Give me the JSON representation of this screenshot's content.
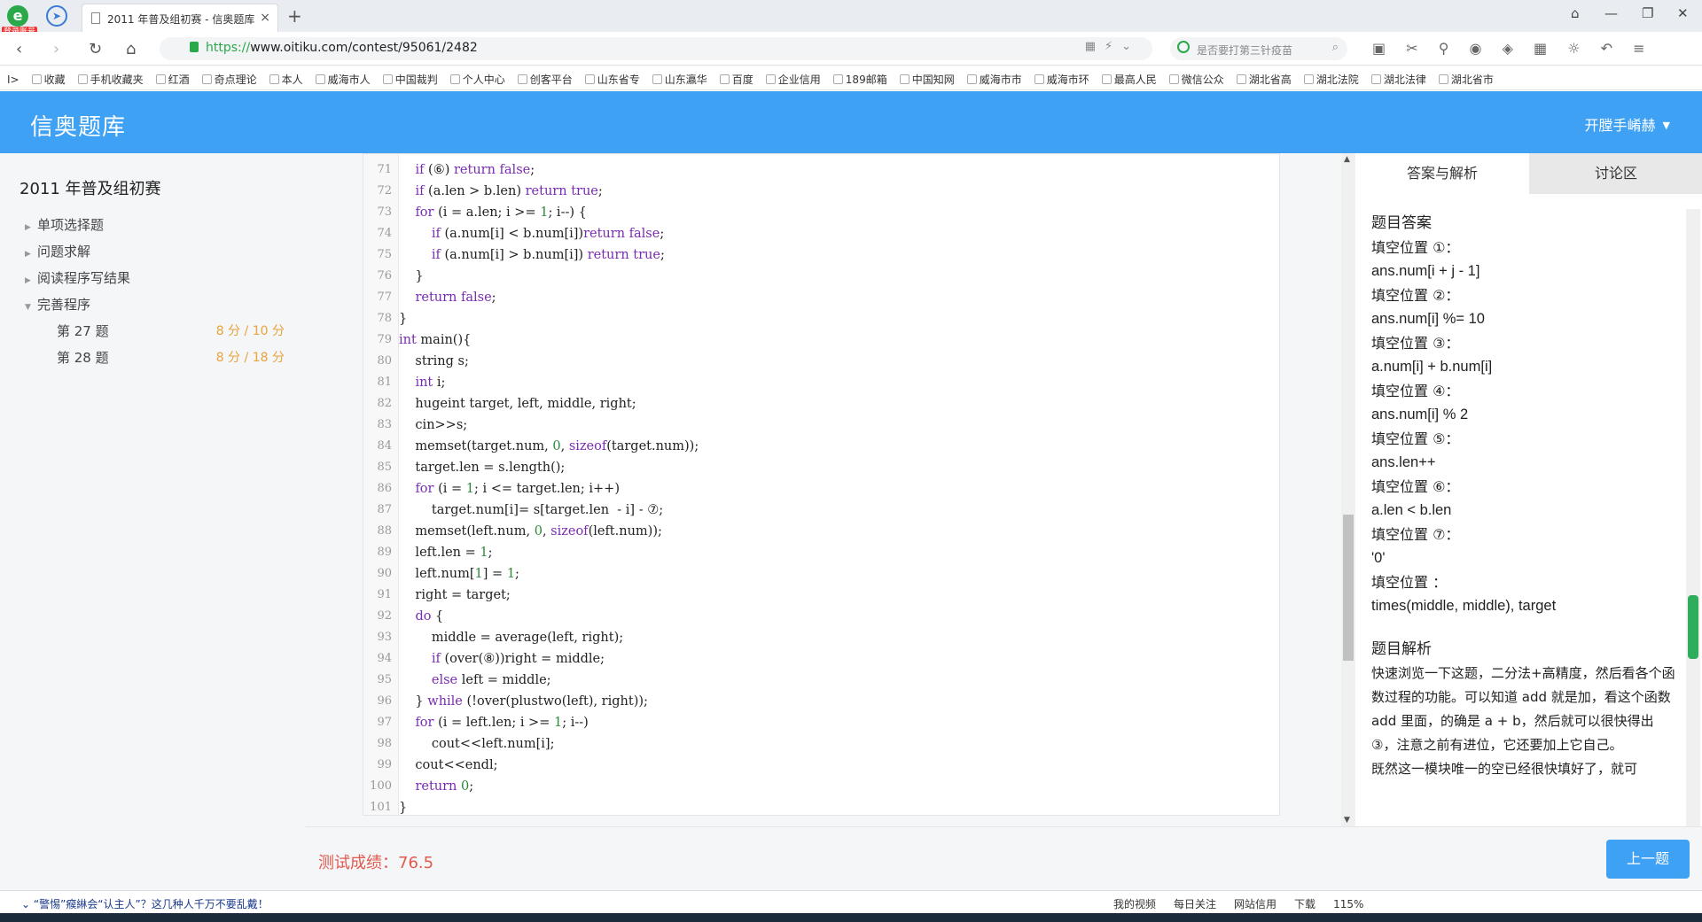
{
  "browser": {
    "logo_badge": "登录账号",
    "tab_title": "2011 年普及组初赛 - 信奥题库",
    "url_scheme": "https://",
    "url_rest": "www.oitiku.com/contest/95061/2482",
    "search_placeholder": "是否要打第三针疫苗",
    "bookmarks": [
      "收藏",
      "手机收藏夹",
      "红酒",
      "奇点理论",
      "本人",
      "威海市人",
      "中国裁判",
      "个人中心",
      "创客平台",
      "山东省专",
      "山东瀛华",
      "百度",
      "企业信用",
      "189邮箱",
      "中国知网",
      "威海市市",
      "威海市环",
      "最高人民",
      "微信公众",
      "湖北省高",
      "湖北法院",
      "湖北法律",
      "湖北省市"
    ]
  },
  "header": {
    "brand": "信奥题库",
    "user": "开膛手崤赫"
  },
  "sidebar": {
    "contest_title": "2011 年普及组初赛",
    "sections": [
      "单项选择题",
      "问题求解",
      "阅读程序写结果",
      "完善程序"
    ],
    "problems": [
      {
        "label": "第 27 题",
        "score": "8 分 / 10 分"
      },
      {
        "label": "第 28 题",
        "score": "8 分 / 18 分"
      }
    ]
  },
  "code": [
    {
      "n": "71",
      "t": "    if (⑥) return false;"
    },
    {
      "n": "72",
      "t": "    if (a.len > b.len) return true;"
    },
    {
      "n": "73",
      "t": "    for (i = a.len; i >= 1; i--) {"
    },
    {
      "n": "74",
      "t": "        if (a.num[i] < b.num[i])return false;"
    },
    {
      "n": "75",
      "t": "        if (a.num[i] > b.num[i]) return true;"
    },
    {
      "n": "76",
      "t": "    }"
    },
    {
      "n": "77",
      "t": "    return false;"
    },
    {
      "n": "78",
      "t": "}"
    },
    {
      "n": "79",
      "t": "int main(){"
    },
    {
      "n": "80",
      "t": "    string s;"
    },
    {
      "n": "81",
      "t": "    int i;"
    },
    {
      "n": "82",
      "t": "    hugeint target, left, middle, right;"
    },
    {
      "n": "83",
      "t": "    cin>>s;"
    },
    {
      "n": "84",
      "t": "    memset(target.num, 0, sizeof(target.num));"
    },
    {
      "n": "85",
      "t": "    target.len = s.length();"
    },
    {
      "n": "86",
      "t": "    for (i = 1; i <= target.len; i++)"
    },
    {
      "n": "87",
      "t": "        target.num[i]= s[target.len  - i] - ⑦;"
    },
    {
      "n": "88",
      "t": "    memset(left.num, 0, sizeof(left.num));"
    },
    {
      "n": "89",
      "t": "    left.len = 1;"
    },
    {
      "n": "90",
      "t": "    left.num[1] = 1;"
    },
    {
      "n": "91",
      "t": "    right = target;"
    },
    {
      "n": "92",
      "t": "    do {"
    },
    {
      "n": "93",
      "t": "        middle = average(left, right);"
    },
    {
      "n": "94",
      "t": "        if (over(⑧))right = middle;"
    },
    {
      "n": "95",
      "t": "        else left = middle;"
    },
    {
      "n": "96",
      "t": "    } while (!over(plustwo(left), right));"
    },
    {
      "n": "97",
      "t": "    for (i = left.len; i >= 1; i--)"
    },
    {
      "n": "98",
      "t": "        cout<<left.num[i];"
    },
    {
      "n": "99",
      "t": "    cout<<endl;"
    },
    {
      "n": "100",
      "t": "    return 0;"
    },
    {
      "n": "101",
      "t": "}"
    }
  ],
  "panel": {
    "tab_answer": "答案与解析",
    "tab_discussion": "讨论区",
    "answer_title": "题目答案",
    "answers": [
      {
        "label": "填空位置 ①：",
        "value": "ans.num[i + j - 1]"
      },
      {
        "label": "填空位置 ②：",
        "value": "ans.num[i] %= 10"
      },
      {
        "label": "填空位置 ③：",
        "value": "a.num[i] + b.num[i]"
      },
      {
        "label": "填空位置 ④：",
        "value": "ans.num[i] % 2"
      },
      {
        "label": "填空位置 ⑤：",
        "value": "ans.len++"
      },
      {
        "label": "填空位置 ⑥：",
        "value": "a.len < b.len"
      },
      {
        "label": "填空位置 ⑦：",
        "value": "'0'"
      },
      {
        "label": "填空位置  ：",
        "value": "times(middle, middle), target"
      }
    ],
    "analysis_title": "题目解析",
    "analysis_text": "快速浏览一下这题，二分法+高精度，然后看各个函数过程的功能。可以知道 add 就是加，看这个函数 add 里面，的确是 a + b，然后就可以很快得出 ③，注意之前有进位，它还要加上它自己。",
    "analysis_text2": "既然这一模块唯一的空已经很快填好了，就可"
  },
  "footer": {
    "score": "测试成绩：76.5",
    "prev_button": "上一题"
  },
  "status": {
    "news": "“警惕”瘊綝会“认主人”？这几种人千万不要乱戴！",
    "items": [
      "我的视频",
      "每日关注",
      "网站信用",
      "下载",
      "115%"
    ]
  }
}
